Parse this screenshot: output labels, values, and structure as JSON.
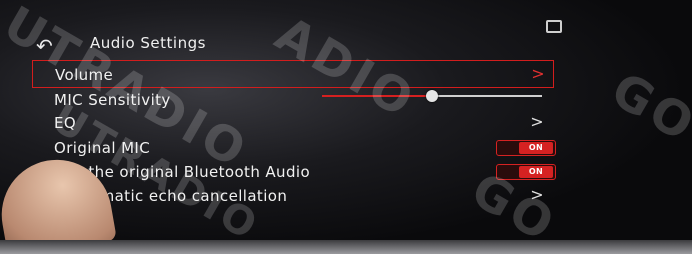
{
  "header": {
    "title": "Audio Settings"
  },
  "rows": [
    {
      "label": "Volume",
      "control": ">"
    },
    {
      "label": "MIC Sensitivity",
      "slider_level": 0.5
    },
    {
      "label": "EQ",
      "control": ">"
    },
    {
      "label": "Original MIC",
      "toggle": "ON"
    },
    {
      "label": "Use the original Bluetooth Audio",
      "toggle": "ON"
    },
    {
      "label": "omatic echo cancellation",
      "control": ">"
    }
  ],
  "watermarks": [
    "UTRADIO",
    "ADIO",
    "GO",
    "UTRADIO",
    "GO"
  ],
  "colors": {
    "accent": "#d21d1d",
    "text": "#f1f1f1"
  }
}
